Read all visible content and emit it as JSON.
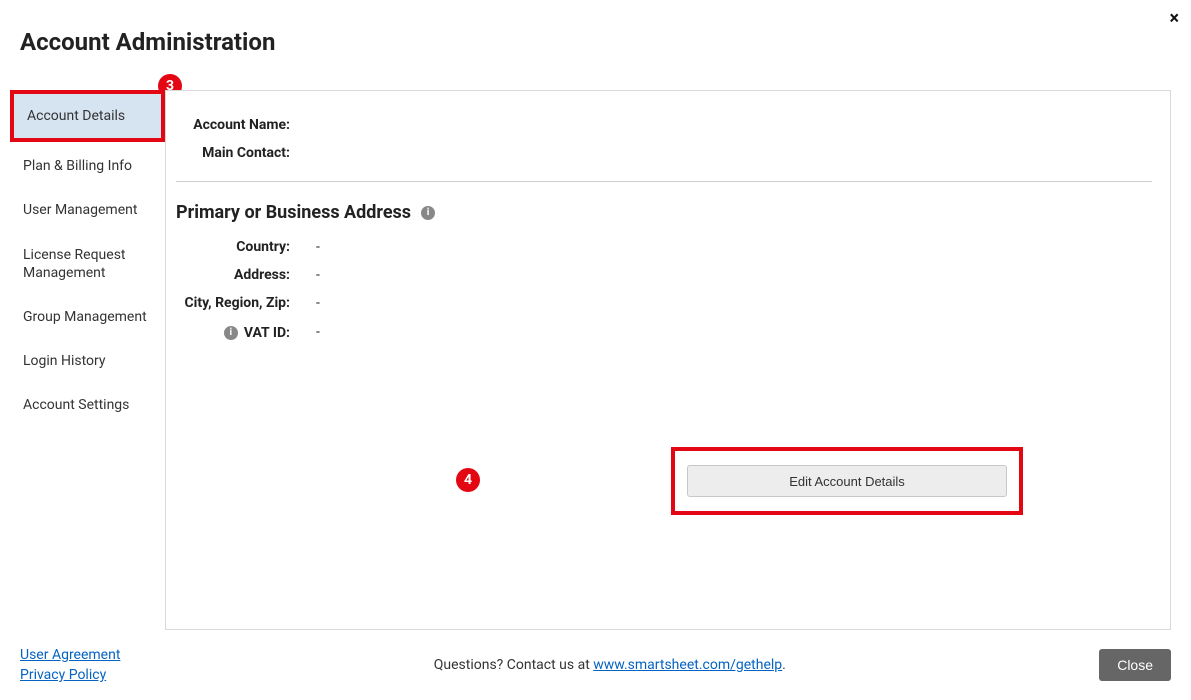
{
  "close_x": "×",
  "page_title": "Account Administration",
  "sidebar": {
    "items": [
      {
        "label": "Account Details",
        "active": true,
        "highlighted": true
      },
      {
        "label": "Plan & Billing Info"
      },
      {
        "label": "User Management"
      },
      {
        "label": "License Request Management"
      },
      {
        "label": "Group Management"
      },
      {
        "label": "Login History"
      },
      {
        "label": "Account Settings"
      }
    ]
  },
  "details": {
    "account_name_label": "Account Name:",
    "account_name_value": "",
    "main_contact_label": "Main Contact:",
    "main_contact_value": ""
  },
  "address_section": {
    "title": "Primary or Business Address",
    "country_label": "Country:",
    "country_value": "-",
    "address_label": "Address:",
    "address_value": "-",
    "city_label": "City, Region, Zip:",
    "city_value": "-",
    "vat_label": "VAT ID:",
    "vat_value": "-"
  },
  "edit_button": "Edit Account Details",
  "callouts": {
    "three": "3",
    "four": "4"
  },
  "footer": {
    "user_agreement": "User Agreement",
    "privacy_policy": "Privacy Policy",
    "questions_prefix": "Questions? Contact us at ",
    "help_link_text": "www.smartsheet.com/gethelp",
    "questions_suffix": ".",
    "close": "Close"
  },
  "info_glyph": "i"
}
